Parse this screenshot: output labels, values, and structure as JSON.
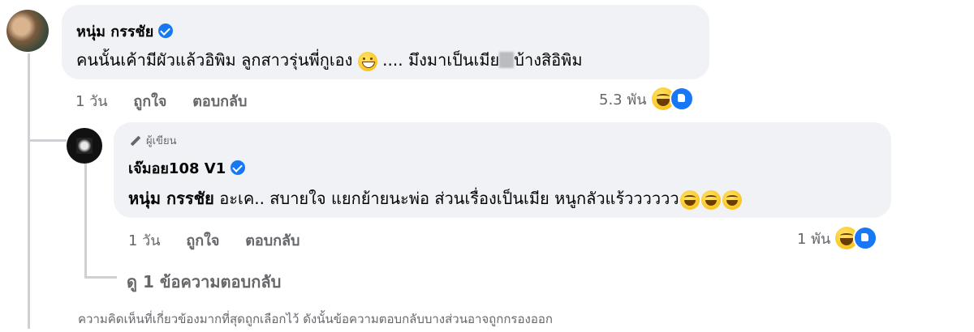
{
  "comment": {
    "author": "หนุ่ม กรรชัย",
    "text_part1": "คนนั้นเค้ามีผัวแล้วอิพิม ลูกสาวรุ่นพี่กู",
    "text_part2": "เอง",
    "text_part3": " .... มึงมาเป็นเมีย",
    "text_part4": "บ้างสิอิพิม",
    "time": "1 วัน",
    "like_label": "ถูกใจ",
    "reply_label": "ตอบกลับ",
    "reaction_count": "5.3 พัน"
  },
  "reply": {
    "author_tag": "ผู้เขียน",
    "author": "เจ๊มอย108 V1",
    "mention": "หนุ่ม กรรชัย",
    "text": " อะเค.. สบายใจ แยกย้ายนะพ่อ ส่วนเรื่องเป็นเมีย หนูกลัวแร้วววววว",
    "time": "1 วัน",
    "like_label": "ถูกใจ",
    "reply_label": "ตอบกลับ",
    "reaction_count": "1 พัน"
  },
  "view_replies": "ดู 1 ข้อความตอบกลับ",
  "footer_note": "ความคิดเห็นที่เกี่ยวข้องมากที่สุดถูกเลือกไว้ ดังนั้นข้อความตอบกลับบางส่วนอาจถูกกรองออก",
  "colors": {
    "bubble": "#f0f2f5",
    "meta": "#65676b",
    "verified": "#1877f2"
  }
}
